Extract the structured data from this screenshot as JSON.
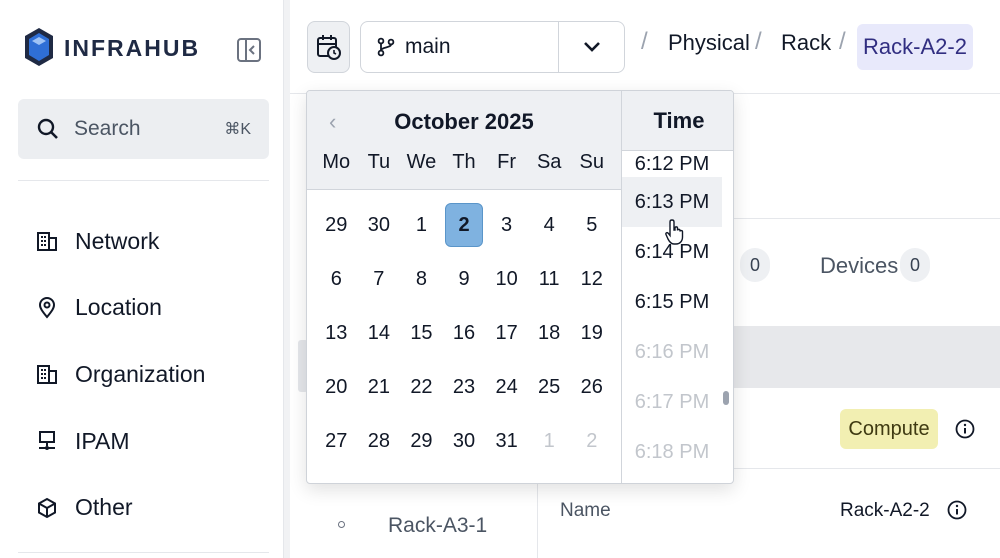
{
  "sidebar": {
    "logo_text": "INFRAHUB",
    "search": {
      "label": "Search",
      "shortcut": "⌘K"
    },
    "items": [
      {
        "label": "Network",
        "icon": "building-icon"
      },
      {
        "label": "Location",
        "icon": "map-pin-icon"
      },
      {
        "label": "Organization",
        "icon": "building-icon"
      },
      {
        "label": "IPAM",
        "icon": "network-icon"
      },
      {
        "label": "Other",
        "icon": "cube-icon"
      }
    ]
  },
  "topbar": {
    "branch": "main",
    "breadcrumb": [
      "Physical",
      "Rack"
    ],
    "current": "Rack-A2-2"
  },
  "calendar": {
    "month_title": "October 2025",
    "weekdays": [
      "Mo",
      "Tu",
      "We",
      "Th",
      "Fr",
      "Sa",
      "Su"
    ],
    "weeks": [
      [
        "29",
        "30",
        "1",
        "2",
        "3",
        "4",
        "5"
      ],
      [
        "6",
        "7",
        "8",
        "9",
        "10",
        "11",
        "12"
      ],
      [
        "13",
        "14",
        "15",
        "16",
        "17",
        "18",
        "19"
      ],
      [
        "20",
        "21",
        "22",
        "23",
        "24",
        "25",
        "26"
      ],
      [
        "27",
        "28",
        "29",
        "30",
        "31",
        "1",
        "2"
      ]
    ],
    "selected_day": "2",
    "time_header": "Time",
    "times": [
      "6:12 PM",
      "6:13 PM",
      "6:14 PM",
      "6:15 PM",
      "6:16 PM",
      "6:17 PM",
      "6:18 PM"
    ]
  },
  "content": {
    "tab_count_1": "0",
    "devices_tab": "Devices",
    "devices_count": "0",
    "badge": "Compute",
    "name_label": "Name",
    "name_value": "Rack-A2-2",
    "tree_item": "Rack-A3-1"
  },
  "colors": {
    "accent": "#7fb2e0",
    "breadcrumb_active_bg": "#e8e9fb",
    "badge_bg": "#f2efb2"
  }
}
